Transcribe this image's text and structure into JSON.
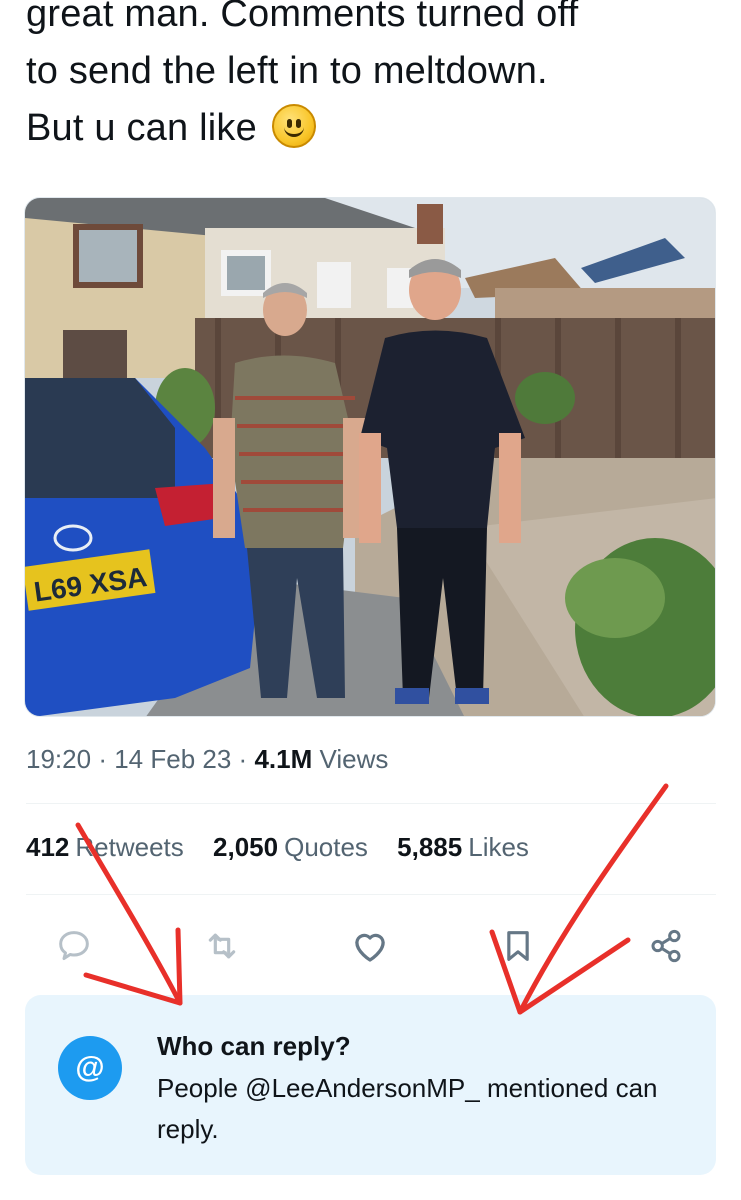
{
  "tweet": {
    "lines": [
      "great man. Comments turned off",
      "to send the left in to meltdown.",
      "But u can like"
    ],
    "emoji": "slightly-smiling-face",
    "plate_text": "L69 XSA"
  },
  "meta": {
    "time": "19:20",
    "separator": "·",
    "date": "14 Feb 23",
    "views_count": "4.1M",
    "views_label": "Views"
  },
  "stats": {
    "retweets_count": "412",
    "retweets_label": "Retweets",
    "quotes_count": "2,050",
    "quotes_label": "Quotes",
    "likes_count": "5,885",
    "likes_label": "Likes"
  },
  "actions": {
    "icons": [
      "comment-icon",
      "retweet-icon",
      "heart-icon",
      "bookmark-icon",
      "share-icon"
    ]
  },
  "reply_restriction": {
    "badge": "@",
    "title": "Who can reply?",
    "body": "People @LeeAndersonMP_ mentioned can reply."
  },
  "colors": {
    "text_primary": "#0f1419",
    "text_secondary": "#536471",
    "action_icon": "#b6c0c8",
    "accent_blue": "#1d9bf0",
    "reply_card_bg": "#e8f5fd",
    "annotation_arrow": "#e8302a"
  }
}
